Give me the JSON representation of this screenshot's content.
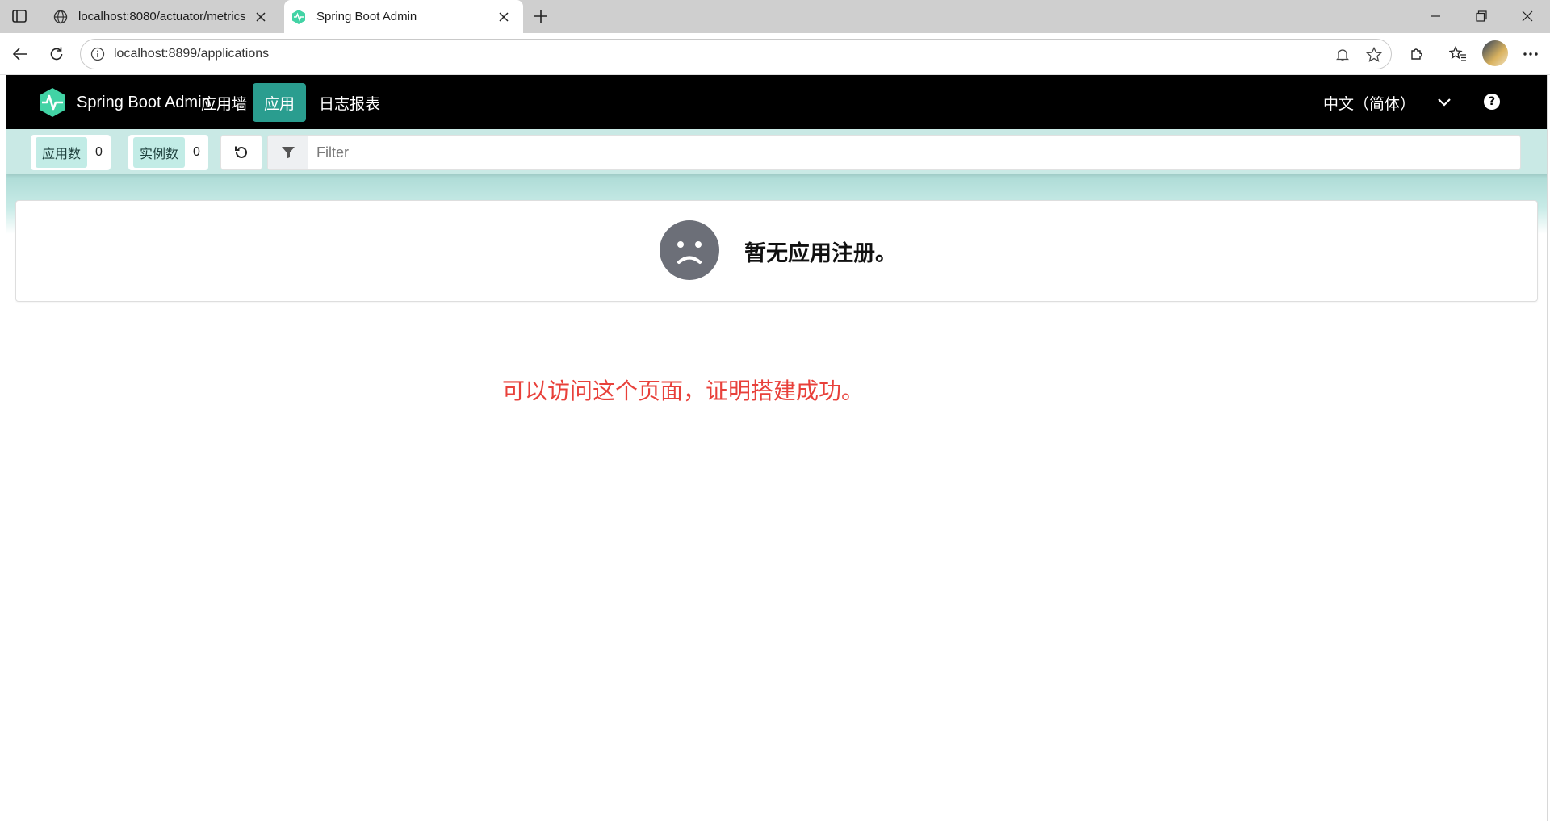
{
  "browser": {
    "tabs": [
      {
        "title": "localhost:8080/actuator/metrics",
        "active": false
      },
      {
        "title": "Spring Boot Admin",
        "active": true
      }
    ],
    "address": "localhost:8899/applications"
  },
  "navbar": {
    "brand": "Spring Boot Admin",
    "items": [
      "应用墙",
      "应用",
      "日志报表"
    ],
    "active_item": "应用",
    "language": "中文（简体）"
  },
  "filterbar": {
    "apps_label": "应用数",
    "apps_count": "0",
    "instances_label": "实例数",
    "instances_count": "0",
    "filter_placeholder": "Filter"
  },
  "empty_state": {
    "message": "暂无应用注册。"
  },
  "annotation": "可以访问这个页面，证明搭建成功。",
  "colors": {
    "nav_background": "#000000",
    "accent": "#2a9d8f",
    "stat_label_bg": "#c2ece6",
    "annotation": "#e8403a"
  }
}
